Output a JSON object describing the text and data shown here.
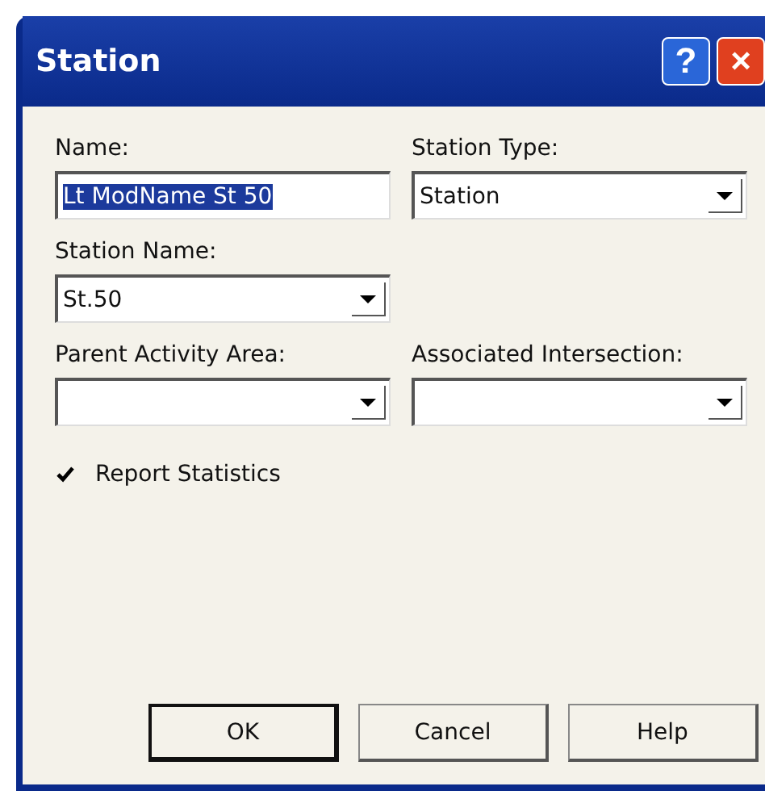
{
  "window": {
    "title": "Station",
    "buttons": [
      {
        "kind": "help",
        "label": "?"
      },
      {
        "kind": "close",
        "label": "×"
      }
    ]
  },
  "fields": [
    {
      "label": "Name:",
      "kind": "text",
      "value": "Lt ModName St 50",
      "selected": true
    },
    {
      "label": "Station Type:",
      "kind": "combo",
      "value": "Station"
    },
    {
      "label": "Station Name:",
      "kind": "combo",
      "value": "St.50"
    },
    {
      "kind": "spacer"
    },
    {
      "label": "Parent Activity Area:",
      "kind": "combo"
    },
    {
      "label": "Associated Intersection:",
      "kind": "combo"
    }
  ],
  "checkbox": {
    "label": "Report Statistics",
    "checked": true
  },
  "buttons": [
    {
      "label": "OK",
      "default": true
    },
    {
      "label": "Cancel",
      "default": false
    },
    {
      "label": "Help",
      "default": false
    }
  ]
}
